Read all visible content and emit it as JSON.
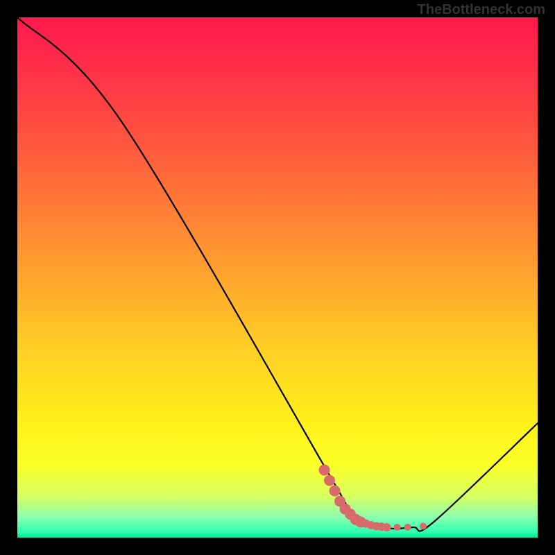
{
  "watermark": "TheBottleneck.com",
  "chart_data": {
    "type": "line",
    "title": "",
    "xlabel": "",
    "ylabel": "",
    "xlim": [
      0,
      100
    ],
    "ylim": [
      0,
      100
    ],
    "series": [
      {
        "name": "curve",
        "x": [
          0,
          20,
          60,
          64,
          70,
          76,
          80,
          100
        ],
        "values": [
          100,
          80,
          12,
          5,
          2,
          2,
          3,
          22
        ]
      }
    ],
    "markers": {
      "name": "highlight",
      "color": "#d96a6a",
      "points": [
        {
          "x": 59,
          "y": 13
        },
        {
          "x": 60,
          "y": 11
        },
        {
          "x": 61,
          "y": 9
        },
        {
          "x": 62,
          "y": 7
        },
        {
          "x": 63,
          "y": 5.5
        },
        {
          "x": 64,
          "y": 4.5
        },
        {
          "x": 65,
          "y": 3.5
        },
        {
          "x": 66,
          "y": 3
        },
        {
          "x": 67,
          "y": 2.7
        },
        {
          "x": 68,
          "y": 2.4
        },
        {
          "x": 69,
          "y": 2.2
        },
        {
          "x": 70,
          "y": 2.1
        },
        {
          "x": 71,
          "y": 2.0
        },
        {
          "x": 73,
          "y": 2.0
        },
        {
          "x": 75,
          "y": 2.0
        },
        {
          "x": 78,
          "y": 2.2
        }
      ]
    },
    "gradient_stops": [
      {
        "pos": 0,
        "color": "#ff1a4d"
      },
      {
        "pos": 50,
        "color": "#ffa52d"
      },
      {
        "pos": 80,
        "color": "#fff01a"
      },
      {
        "pos": 100,
        "color": "#00e090"
      }
    ]
  }
}
